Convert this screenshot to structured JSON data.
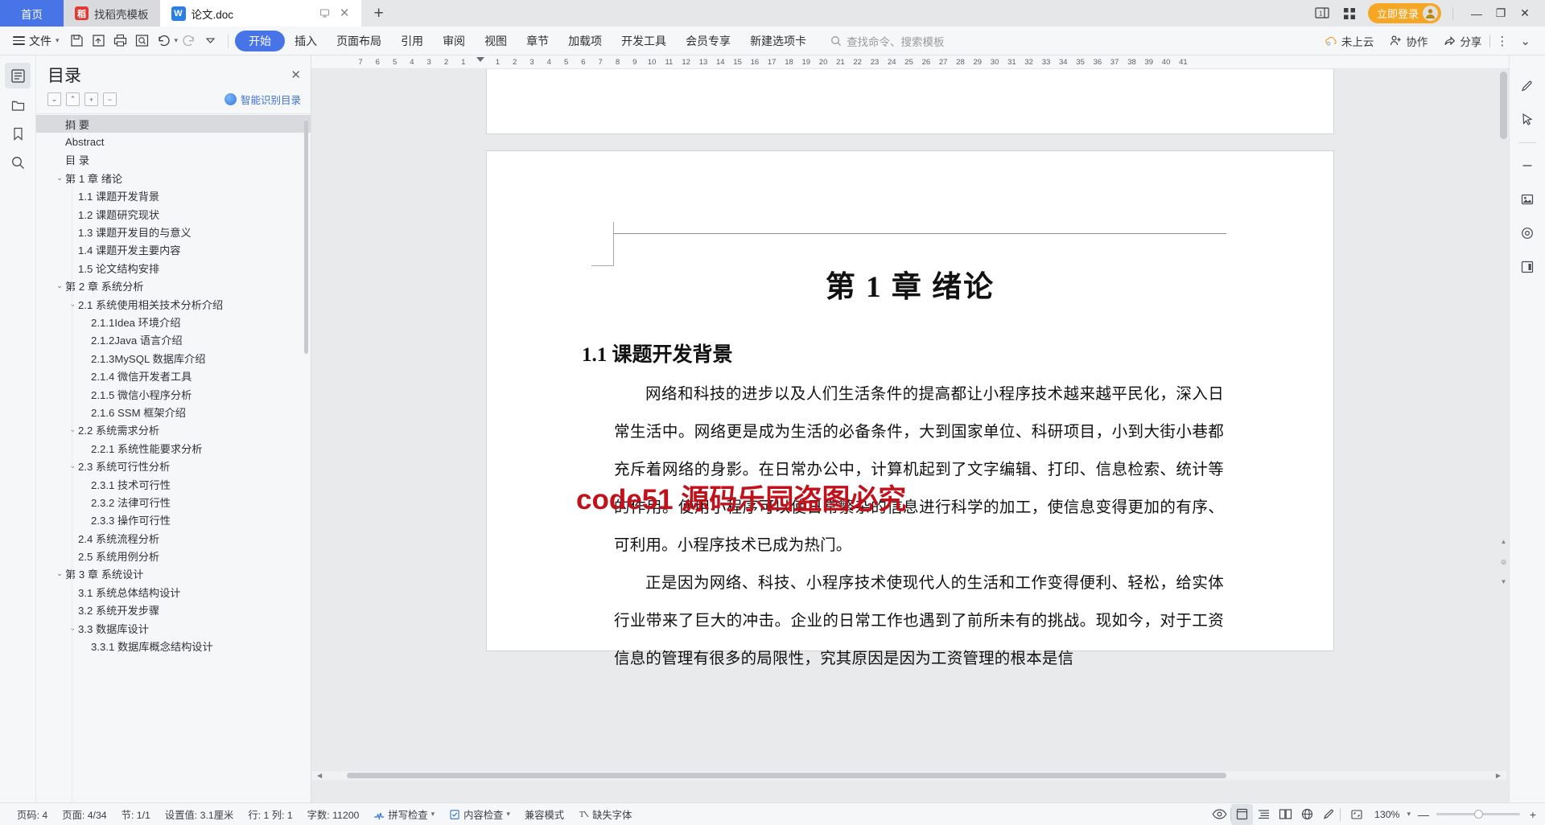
{
  "window": {
    "tabs": [
      {
        "label": "首页",
        "type": "home"
      },
      {
        "label": "找稻壳模板",
        "type": "docer"
      },
      {
        "label": "论文.doc",
        "type": "doc"
      }
    ],
    "new_tab_label": "+",
    "login_label": "立即登录",
    "minimize_label": "—",
    "restore_label": "❐",
    "close_label": "✕"
  },
  "ribbon": {
    "file_label": "文件",
    "tabs": [
      {
        "label": "开始",
        "active": true
      },
      {
        "label": "插入",
        "active": false
      },
      {
        "label": "页面布局",
        "active": false
      },
      {
        "label": "引用",
        "active": false
      },
      {
        "label": "审阅",
        "active": false
      },
      {
        "label": "视图",
        "active": false
      },
      {
        "label": "章节",
        "active": false
      },
      {
        "label": "加载项",
        "active": false
      },
      {
        "label": "开发工具",
        "active": false
      },
      {
        "label": "会员专享",
        "active": false
      },
      {
        "label": "新建选项卡",
        "active": false
      }
    ],
    "search_placeholder": "查找命令、搜索模板",
    "cloud_label": "未上云",
    "collab_label": "协作",
    "share_label": "分享",
    "more_label": "⋮"
  },
  "outline": {
    "title": "目录",
    "ai_label": "智能识别目录",
    "items": [
      {
        "label": "摘 要",
        "indent": 0,
        "chev": "",
        "selected": true
      },
      {
        "label": "Abstract",
        "indent": 0,
        "chev": "",
        "selected": false
      },
      {
        "label": "目 录",
        "indent": 0,
        "chev": "",
        "selected": false
      },
      {
        "label": "第 1 章   绪论",
        "indent": 0,
        "chev": "v",
        "selected": false
      },
      {
        "label": "1.1 课题开发背景",
        "indent": 1,
        "chev": "",
        "selected": false
      },
      {
        "label": "1.2 课题研究现状",
        "indent": 1,
        "chev": "",
        "selected": false
      },
      {
        "label": "1.3 课题开发目的与意义",
        "indent": 1,
        "chev": "",
        "selected": false
      },
      {
        "label": "1.4 课题开发主要内容",
        "indent": 1,
        "chev": "",
        "selected": false
      },
      {
        "label": "1.5 论文结构安排",
        "indent": 1,
        "chev": "",
        "selected": false
      },
      {
        "label": "第 2 章  系统分析",
        "indent": 0,
        "chev": "v",
        "selected": false
      },
      {
        "label": "2.1 系统使用相关技术分析介绍",
        "indent": 1,
        "chev": "v",
        "selected": false
      },
      {
        "label": "2.1.1Idea 环境介绍",
        "indent": 2,
        "chev": "",
        "selected": false
      },
      {
        "label": "2.1.2Java 语言介绍",
        "indent": 2,
        "chev": "",
        "selected": false
      },
      {
        "label": " 2.1.3MySQL 数据库介绍",
        "indent": 2,
        "chev": "",
        "selected": false
      },
      {
        "label": "2.1.4 微信开发者工具",
        "indent": 2,
        "chev": "",
        "selected": false
      },
      {
        "label": "2.1.5 微信小程序分析",
        "indent": 2,
        "chev": "",
        "selected": false
      },
      {
        "label": "2.1.6 SSM 框架介绍",
        "indent": 2,
        "chev": "",
        "selected": false
      },
      {
        "label": "2.2 系统需求分析",
        "indent": 1,
        "chev": "v",
        "selected": false
      },
      {
        "label": "2.2.1 系统性能要求分析",
        "indent": 2,
        "chev": "",
        "selected": false
      },
      {
        "label": "2.3 系统可行性分析",
        "indent": 1,
        "chev": "v",
        "selected": false
      },
      {
        "label": "2.3.1 技术可行性",
        "indent": 2,
        "chev": "",
        "selected": false
      },
      {
        "label": "2.3.2 法律可行性",
        "indent": 2,
        "chev": "",
        "selected": false
      },
      {
        "label": "2.3.3 操作可行性",
        "indent": 2,
        "chev": "",
        "selected": false
      },
      {
        "label": "2.4 系统流程分析",
        "indent": 1,
        "chev": "",
        "selected": false
      },
      {
        "label": "2.5 系统用例分析",
        "indent": 1,
        "chev": "",
        "selected": false
      },
      {
        "label": "第 3 章  系统设计",
        "indent": 0,
        "chev": "v",
        "selected": false
      },
      {
        "label": "3.1 系统总体结构设计",
        "indent": 1,
        "chev": "",
        "selected": false
      },
      {
        "label": "3.2 系统开发步骤",
        "indent": 1,
        "chev": "",
        "selected": false
      },
      {
        "label": "3.3 数据库设计",
        "indent": 1,
        "chev": "v",
        "selected": false
      },
      {
        "label": "3.3.1 数据库概念结构设计",
        "indent": 2,
        "chev": "",
        "selected": false
      }
    ]
  },
  "ruler": {
    "ticks": [
      "7",
      "6",
      "5",
      "4",
      "3",
      "2",
      "1",
      "",
      "1",
      "2",
      "3",
      "4",
      "5",
      "6",
      "7",
      "8",
      "9",
      "10",
      "11",
      "12",
      "13",
      "14",
      "15",
      "16",
      "17",
      "18",
      "19",
      "20",
      "21",
      "22",
      "23",
      "24",
      "25",
      "26",
      "27",
      "28",
      "29",
      "30",
      "31",
      "32",
      "33",
      "34",
      "35",
      "36",
      "37",
      "38",
      "39",
      "40",
      "41"
    ]
  },
  "document": {
    "chapter_title": "第 1 章    绪论",
    "section_title": "1.1 课题开发背景",
    "watermark": "code51 源码乐园盗图必究",
    "paragraphs": [
      "网络和科技的进步以及人们生活条件的提高都让小程序技术越来越平民化，深入日常生活中。网络更是成为生活的必备条件，大到国家单位、科研项目，小到大街小巷都充斥着网络的身影。在日常办公中，计算机起到了文字编辑、打印、信息检索、统计等的作用。使用小程序可以使日常繁杂的信息进行科学的加工，使信息变得更加的有序、可利用。小程序技术已成为热门。",
      "正是因为网络、科技、小程序技术使现代人的生活和工作变得便利、轻松，给实体行业带来了巨大的冲击。企业的日常工作也遇到了前所未有的挑战。现如今，对于工资信息的管理有很多的局限性，究其原因是因为工资管理的根本是信"
    ]
  },
  "status": {
    "page_no": "页码: 4",
    "pages": "页面: 4/34",
    "section": "节: 1/1",
    "setting": "设置值: 3.1厘米",
    "line_col": "行: 1 列: 1",
    "word_count": "字数: 11200",
    "spellcheck": "拼写检查",
    "contentcheck": "内容检查",
    "compat": "兼容模式",
    "missing_font": "缺失字体",
    "zoom": "130%",
    "zoom_minus": "—",
    "zoom_plus": "+"
  }
}
